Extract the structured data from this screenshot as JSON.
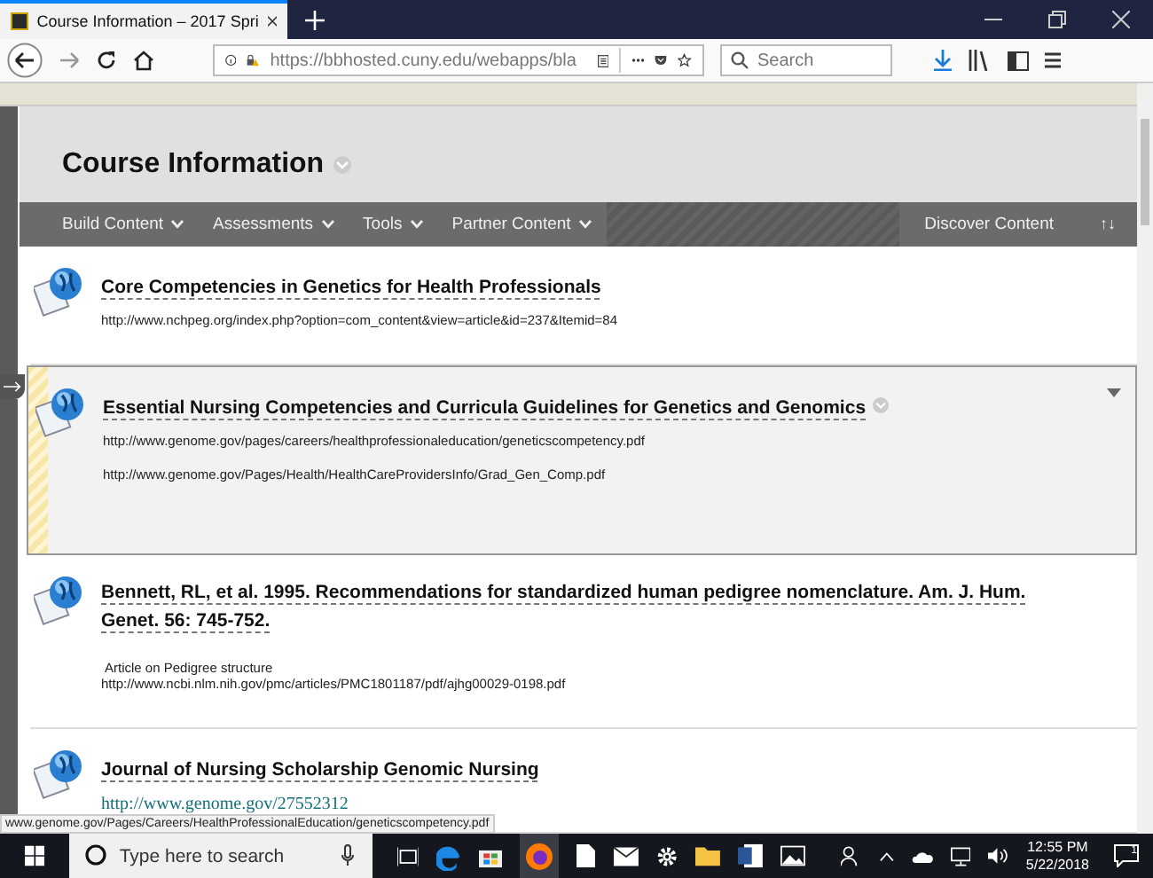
{
  "browser": {
    "tab_title": "Course Information – 2017 Spri",
    "address": "https://bbhosted.cuny.edu/webapps/bla",
    "search_placeholder": "Search"
  },
  "page": {
    "title": "Course Information",
    "toolbar": [
      {
        "label": "Build Content"
      },
      {
        "label": "Assessments"
      },
      {
        "label": "Tools"
      },
      {
        "label": "Partner Content"
      }
    ],
    "discover": "Discover Content",
    "sort_icon": "↑↓",
    "items": [
      {
        "title": "Core Competencies in Genetics for Health Professionals",
        "selected": false,
        "lines": [
          {
            "kind": "url",
            "text": "http://www.nchpeg.org/index.php?option=com_content&view=article&id=237&Itemid=84"
          }
        ]
      },
      {
        "title": "Essential Nursing Competencies and Curricula Guidelines for Genetics and Genomics",
        "selected": true,
        "lines": [
          {
            "kind": "url",
            "text": "http://www.genome.gov/pages/careers/healthprofessionaleducation/geneticscompetency.pdf"
          },
          {
            "kind": "url",
            "text": "http://www.genome.gov/Pages/Health/HealthCareProvidersInfo/Grad_Gen_Comp.pdf"
          }
        ]
      },
      {
        "title": "Bennett, RL, et al. 1995. Recommendations for standardized human pedigree nomenclature. Am. J. Hum. Genet. 56: 745-752.",
        "selected": false,
        "lines": [
          {
            "kind": "note",
            "text": "Article on Pedigree structure"
          },
          {
            "kind": "url",
            "text": "http://www.ncbi.nlm.nih.gov/pmc/articles/PMC1801187/pdf/ajhg00029-0198.pdf"
          }
        ]
      },
      {
        "title": "Journal of Nursing Scholarship Genomic Nursing",
        "selected": false,
        "lines": [
          {
            "kind": "link",
            "text": "http://www.genome.gov/27552312"
          }
        ]
      }
    ]
  },
  "status_link": "www.genome.gov/Pages/Careers/HealthProfessionalEducation/geneticscompetency.pdf",
  "taskbar": {
    "search_placeholder": "Type here to search",
    "time": "12:55 PM",
    "date": "5/22/2018",
    "notifications": "1"
  }
}
